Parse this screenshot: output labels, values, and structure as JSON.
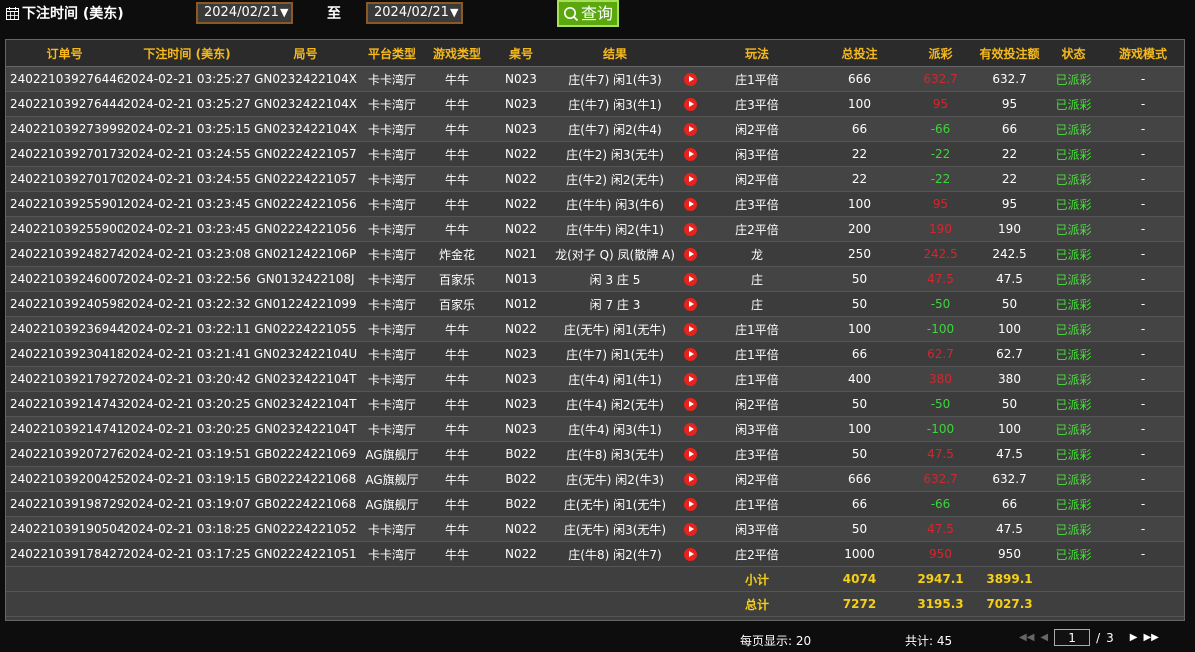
{
  "toolbar": {
    "label": "下注时间 (美东)",
    "start_date": "2024/02/21",
    "to_label": "至",
    "end_date": "2024/02/21",
    "query_label": "查询"
  },
  "table": {
    "headers": [
      "订单号",
      "下注时间 (美东)",
      "局号",
      "平台类型",
      "游戏类型",
      "桌号",
      "结果",
      "",
      "玩法",
      "总投注",
      "派彩",
      "有效投注额",
      "状态",
      "游戏模式"
    ],
    "rows": [
      {
        "order": "240221039276446",
        "time": "2024-02-21 03:25:27",
        "round": "GN0232422104X",
        "platform": "卡卡湾厅",
        "game": "牛牛",
        "table": "N023",
        "result": "庄(牛7) 闲1(牛3)",
        "play": "庄1平倍",
        "bet": "666",
        "payout": "632.7",
        "payout_sign": "win",
        "valid": "632.7",
        "status": "已派彩",
        "mode": "-"
      },
      {
        "order": "240221039276444",
        "time": "2024-02-21 03:25:27",
        "round": "GN0232422104X",
        "platform": "卡卡湾厅",
        "game": "牛牛",
        "table": "N023",
        "result": "庄(牛7) 闲3(牛1)",
        "play": "庄3平倍",
        "bet": "100",
        "payout": "95",
        "payout_sign": "win",
        "valid": "95",
        "status": "已派彩",
        "mode": "-"
      },
      {
        "order": "240221039273999",
        "time": "2024-02-21 03:25:15",
        "round": "GN0232422104X",
        "platform": "卡卡湾厅",
        "game": "牛牛",
        "table": "N023",
        "result": "庄(牛7) 闲2(牛4)",
        "play": "闲2平倍",
        "bet": "66",
        "payout": "-66",
        "payout_sign": "lose",
        "valid": "66",
        "status": "已派彩",
        "mode": "-"
      },
      {
        "order": "240221039270173",
        "time": "2024-02-21 03:24:55",
        "round": "GN02224221057",
        "platform": "卡卡湾厅",
        "game": "牛牛",
        "table": "N022",
        "result": "庄(牛2) 闲3(无牛)",
        "play": "闲3平倍",
        "bet": "22",
        "payout": "-22",
        "payout_sign": "lose",
        "valid": "22",
        "status": "已派彩",
        "mode": "-"
      },
      {
        "order": "240221039270170",
        "time": "2024-02-21 03:24:55",
        "round": "GN02224221057",
        "platform": "卡卡湾厅",
        "game": "牛牛",
        "table": "N022",
        "result": "庄(牛2) 闲2(无牛)",
        "play": "闲2平倍",
        "bet": "22",
        "payout": "-22",
        "payout_sign": "lose",
        "valid": "22",
        "status": "已派彩",
        "mode": "-"
      },
      {
        "order": "240221039255901",
        "time": "2024-02-21 03:23:45",
        "round": "GN02224221056",
        "platform": "卡卡湾厅",
        "game": "牛牛",
        "table": "N022",
        "result": "庄(牛牛) 闲3(牛6)",
        "play": "庄3平倍",
        "bet": "100",
        "payout": "95",
        "payout_sign": "win",
        "valid": "95",
        "status": "已派彩",
        "mode": "-"
      },
      {
        "order": "240221039255900",
        "time": "2024-02-21 03:23:45",
        "round": "GN02224221056",
        "platform": "卡卡湾厅",
        "game": "牛牛",
        "table": "N022",
        "result": "庄(牛牛) 闲2(牛1)",
        "play": "庄2平倍",
        "bet": "200",
        "payout": "190",
        "payout_sign": "win",
        "valid": "190",
        "status": "已派彩",
        "mode": "-"
      },
      {
        "order": "240221039248274",
        "time": "2024-02-21 03:23:08",
        "round": "GN0212422106P",
        "platform": "卡卡湾厅",
        "game": "炸金花",
        "table": "N021",
        "result": "龙(对子 Q) 凤(散牌 A)",
        "play": "龙",
        "bet": "250",
        "payout": "242.5",
        "payout_sign": "win",
        "valid": "242.5",
        "status": "已派彩",
        "mode": "-"
      },
      {
        "order": "240221039246007",
        "time": "2024-02-21 03:22:56",
        "round": "GN0132422108J",
        "platform": "卡卡湾厅",
        "game": "百家乐",
        "table": "N013",
        "result": "闲 3 庄 5",
        "play": "庄",
        "bet": "50",
        "payout": "47.5",
        "payout_sign": "win",
        "valid": "47.5",
        "status": "已派彩",
        "mode": "-"
      },
      {
        "order": "240221039240598",
        "time": "2024-02-21 03:22:32",
        "round": "GN01224221099",
        "platform": "卡卡湾厅",
        "game": "百家乐",
        "table": "N012",
        "result": "闲 7 庄 3",
        "play": "庄",
        "bet": "50",
        "payout": "-50",
        "payout_sign": "lose",
        "valid": "50",
        "status": "已派彩",
        "mode": "-"
      },
      {
        "order": "240221039236944",
        "time": "2024-02-21 03:22:11",
        "round": "GN02224221055",
        "platform": "卡卡湾厅",
        "game": "牛牛",
        "table": "N022",
        "result": "庄(无牛) 闲1(无牛)",
        "play": "庄1平倍",
        "bet": "100",
        "payout": "-100",
        "payout_sign": "lose",
        "valid": "100",
        "status": "已派彩",
        "mode": "-"
      },
      {
        "order": "240221039230418",
        "time": "2024-02-21 03:21:41",
        "round": "GN0232422104U",
        "platform": "卡卡湾厅",
        "game": "牛牛",
        "table": "N023",
        "result": "庄(牛7) 闲1(无牛)",
        "play": "庄1平倍",
        "bet": "66",
        "payout": "62.7",
        "payout_sign": "win",
        "valid": "62.7",
        "status": "已派彩",
        "mode": "-"
      },
      {
        "order": "240221039217927",
        "time": "2024-02-21 03:20:42",
        "round": "GN0232422104T",
        "platform": "卡卡湾厅",
        "game": "牛牛",
        "table": "N023",
        "result": "庄(牛4) 闲1(牛1)",
        "play": "庄1平倍",
        "bet": "400",
        "payout": "380",
        "payout_sign": "win",
        "valid": "380",
        "status": "已派彩",
        "mode": "-"
      },
      {
        "order": "240221039214743",
        "time": "2024-02-21 03:20:25",
        "round": "GN0232422104T",
        "platform": "卡卡湾厅",
        "game": "牛牛",
        "table": "N023",
        "result": "庄(牛4) 闲2(无牛)",
        "play": "闲2平倍",
        "bet": "50",
        "payout": "-50",
        "payout_sign": "lose",
        "valid": "50",
        "status": "已派彩",
        "mode": "-"
      },
      {
        "order": "240221039214741",
        "time": "2024-02-21 03:20:25",
        "round": "GN0232422104T",
        "platform": "卡卡湾厅",
        "game": "牛牛",
        "table": "N023",
        "result": "庄(牛4) 闲3(牛1)",
        "play": "闲3平倍",
        "bet": "100",
        "payout": "-100",
        "payout_sign": "lose",
        "valid": "100",
        "status": "已派彩",
        "mode": "-"
      },
      {
        "order": "240221039207276",
        "time": "2024-02-21 03:19:51",
        "round": "GB02224221069",
        "platform": "AG旗舰厅",
        "game": "牛牛",
        "table": "B022",
        "result": "庄(牛8) 闲3(无牛)",
        "play": "庄3平倍",
        "bet": "50",
        "payout": "47.5",
        "payout_sign": "win",
        "valid": "47.5",
        "status": "已派彩",
        "mode": "-"
      },
      {
        "order": "240221039200425",
        "time": "2024-02-21 03:19:15",
        "round": "GB02224221068",
        "platform": "AG旗舰厅",
        "game": "牛牛",
        "table": "B022",
        "result": "庄(无牛) 闲2(牛3)",
        "play": "闲2平倍",
        "bet": "666",
        "payout": "632.7",
        "payout_sign": "win",
        "valid": "632.7",
        "status": "已派彩",
        "mode": "-"
      },
      {
        "order": "240221039198729",
        "time": "2024-02-21 03:19:07",
        "round": "GB02224221068",
        "platform": "AG旗舰厅",
        "game": "牛牛",
        "table": "B022",
        "result": "庄(无牛) 闲1(无牛)",
        "play": "庄1平倍",
        "bet": "66",
        "payout": "-66",
        "payout_sign": "lose",
        "valid": "66",
        "status": "已派彩",
        "mode": "-"
      },
      {
        "order": "240221039190504",
        "time": "2024-02-21 03:18:25",
        "round": "GN02224221052",
        "platform": "卡卡湾厅",
        "game": "牛牛",
        "table": "N022",
        "result": "庄(无牛) 闲3(无牛)",
        "play": "闲3平倍",
        "bet": "50",
        "payout": "47.5",
        "payout_sign": "win",
        "valid": "47.5",
        "status": "已派彩",
        "mode": "-"
      },
      {
        "order": "240221039178427",
        "time": "2024-02-21 03:17:25",
        "round": "GN02224221051",
        "platform": "卡卡湾厅",
        "game": "牛牛",
        "table": "N022",
        "result": "庄(牛8) 闲2(牛7)",
        "play": "庄2平倍",
        "bet": "1000",
        "payout": "950",
        "payout_sign": "win",
        "valid": "950",
        "status": "已派彩",
        "mode": "-"
      }
    ],
    "subtotal": {
      "label": "小计",
      "bet": "4074",
      "payout": "2947.1",
      "valid": "3899.1"
    },
    "total": {
      "label": "总计",
      "bet": "7272",
      "payout": "3195.3",
      "valid": "7027.3"
    },
    "replay_icon": "play-circle-icon"
  },
  "pagination": {
    "page_size_text": "每页显示: 20",
    "total_text": "共计: 45",
    "current_page": "1",
    "separator": "/",
    "total_pages": "3"
  },
  "colors": {
    "header_text": "#f5b91e",
    "status": "#48e03a",
    "payout_win": "#d3272d",
    "payout_lose": "#3bd63b",
    "summary": "#f5cf19",
    "query_button": "#5aa80e"
  }
}
